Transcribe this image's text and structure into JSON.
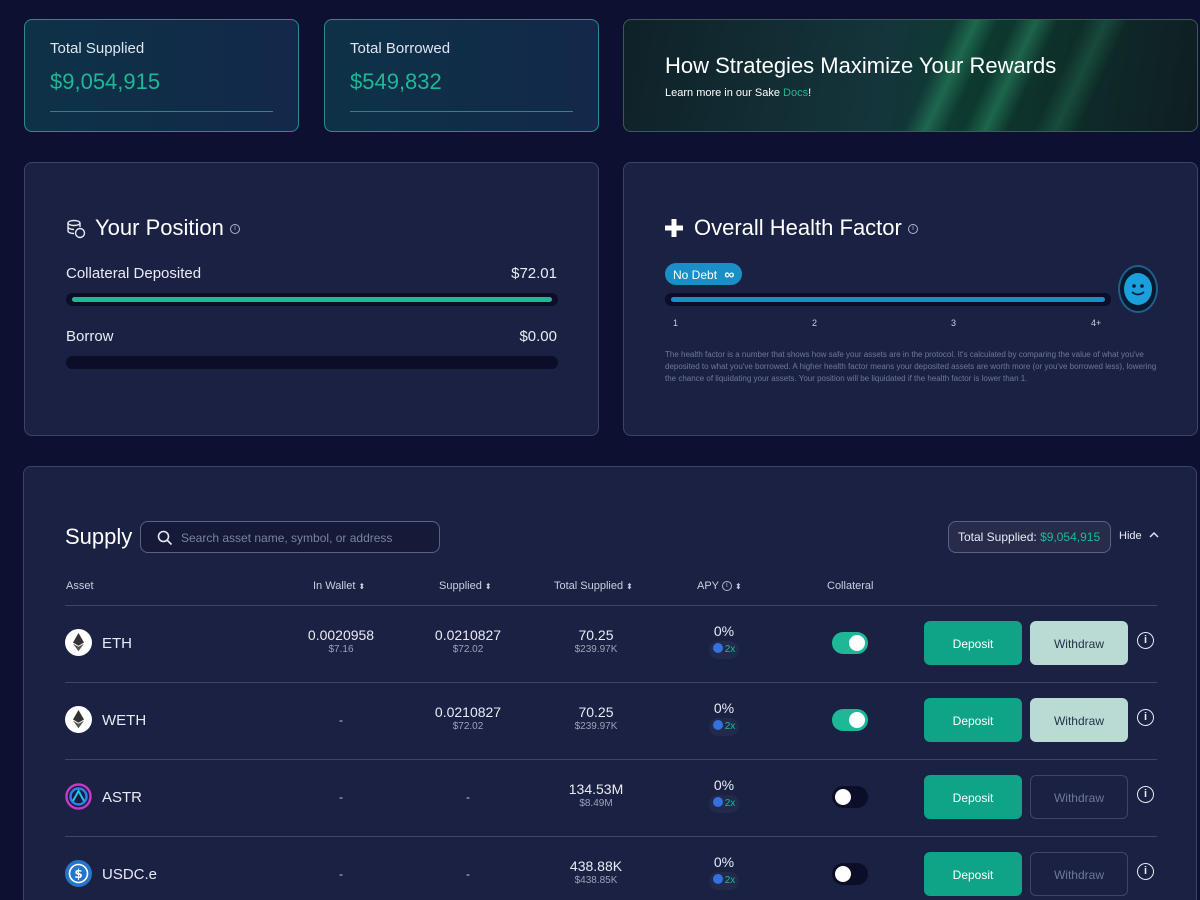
{
  "stats": {
    "total_supplied_label": "Total Supplied",
    "total_supplied_value": "$9,054,915",
    "total_borrowed_label": "Total Borrowed",
    "total_borrowed_value": "$549,832"
  },
  "banner": {
    "title": "How Strategies Maximize Your Rewards",
    "sub_prefix": "Learn more in our Sake ",
    "sub_link": "Docs",
    "sub_suffix": "!"
  },
  "position": {
    "title": "Your Position",
    "collateral_label": "Collateral Deposited",
    "collateral_value": "$72.01",
    "collateral_fill": 1.0,
    "borrow_label": "Borrow",
    "borrow_value": "$0.00",
    "borrow_fill": 0.0
  },
  "health": {
    "title": "Overall Health Factor",
    "badge_label": "No Debt",
    "badge_symbol": "∞",
    "ticks": [
      "1",
      "2",
      "3",
      "4+"
    ],
    "fill": 1.0,
    "description": "The health factor is a number that shows how safe your assets are in the protocol. It's calculated by comparing the value of what you've deposited to what you've borrowed. A higher health factor means your deposited assets are worth more (or you've borrowed less), lowering the chance of liquidating your assets. Your position will be liquidated if the health factor is lower than 1."
  },
  "supply": {
    "title": "Supply",
    "search_placeholder": "Search asset name, symbol, or address",
    "total_label": "Total Supplied: ",
    "total_value": "$9,054,915",
    "hide_label": "Hide",
    "columns": {
      "asset": "Asset",
      "wallet": "In Wallet",
      "supplied": "Supplied",
      "total": "Total Supplied",
      "apy": "APY",
      "collateral": "Collateral"
    },
    "deposit_label": "Deposit",
    "withdraw_label": "Withdraw",
    "rows": [
      {
        "symbol": "ETH",
        "wallet": "0.0020958",
        "wallet_usd": "$7.16",
        "supplied": "0.0210827",
        "supplied_usd": "$72.02",
        "total": "70.25",
        "total_usd": "$239.97K",
        "apy": "0%",
        "boost": "2x",
        "collateral": true
      },
      {
        "symbol": "WETH",
        "wallet": "-",
        "wallet_usd": "",
        "supplied": "0.0210827",
        "supplied_usd": "$72.02",
        "total": "70.25",
        "total_usd": "$239.97K",
        "apy": "0%",
        "boost": "2x",
        "collateral": true
      },
      {
        "symbol": "ASTR",
        "wallet": "-",
        "wallet_usd": "",
        "supplied": "-",
        "supplied_usd": "",
        "total": "134.53M",
        "total_usd": "$8.49M",
        "apy": "0%",
        "boost": "2x",
        "collateral": false
      },
      {
        "symbol": "USDC.e",
        "wallet": "-",
        "wallet_usd": "",
        "supplied": "-",
        "supplied_usd": "",
        "total": "438.88K",
        "total_usd": "$438.85K",
        "apy": "0%",
        "boost": "2x",
        "collateral": false
      }
    ]
  },
  "colors": {
    "accent": "#1fb896",
    "health_blue": "#1a8fc7",
    "background": "#0d1030",
    "card": "#1b2142"
  }
}
